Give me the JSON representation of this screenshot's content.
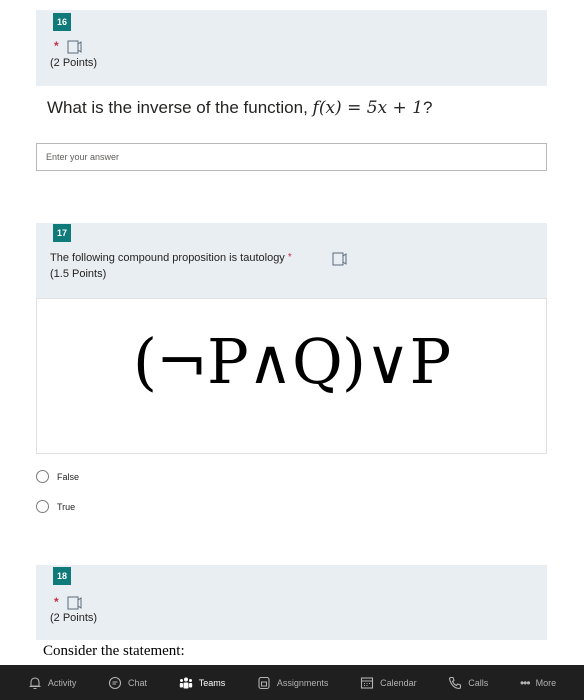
{
  "questions": [
    {
      "number": "16",
      "required_marker": "*",
      "points": "(2 Points)",
      "prompt_prefix": "What is the inverse of the function, ",
      "prompt_math": "f(x) = 5x + 1",
      "prompt_suffix": "?",
      "answer_placeholder": "Enter your answer"
    },
    {
      "number": "17",
      "title": "The following compound proposition is tautology",
      "required_marker": "*",
      "points": "(1.5 Points)",
      "expression": "(¬P∧Q)∨P",
      "options": [
        "False",
        "True"
      ]
    },
    {
      "number": "18",
      "required_marker": "*",
      "points": "(2 Points)",
      "text": "Consider the statement:"
    }
  ],
  "taskbar": {
    "items": [
      "Activity",
      "Chat",
      "Teams",
      "Assignments",
      "Calendar",
      "Calls",
      "More"
    ],
    "active": "Teams"
  },
  "colors": {
    "panel_bg": "#e9eef2",
    "question_number_bg": "#0e7a7a",
    "required": "#c4314b",
    "taskbar_bg": "#1f1f1f"
  }
}
